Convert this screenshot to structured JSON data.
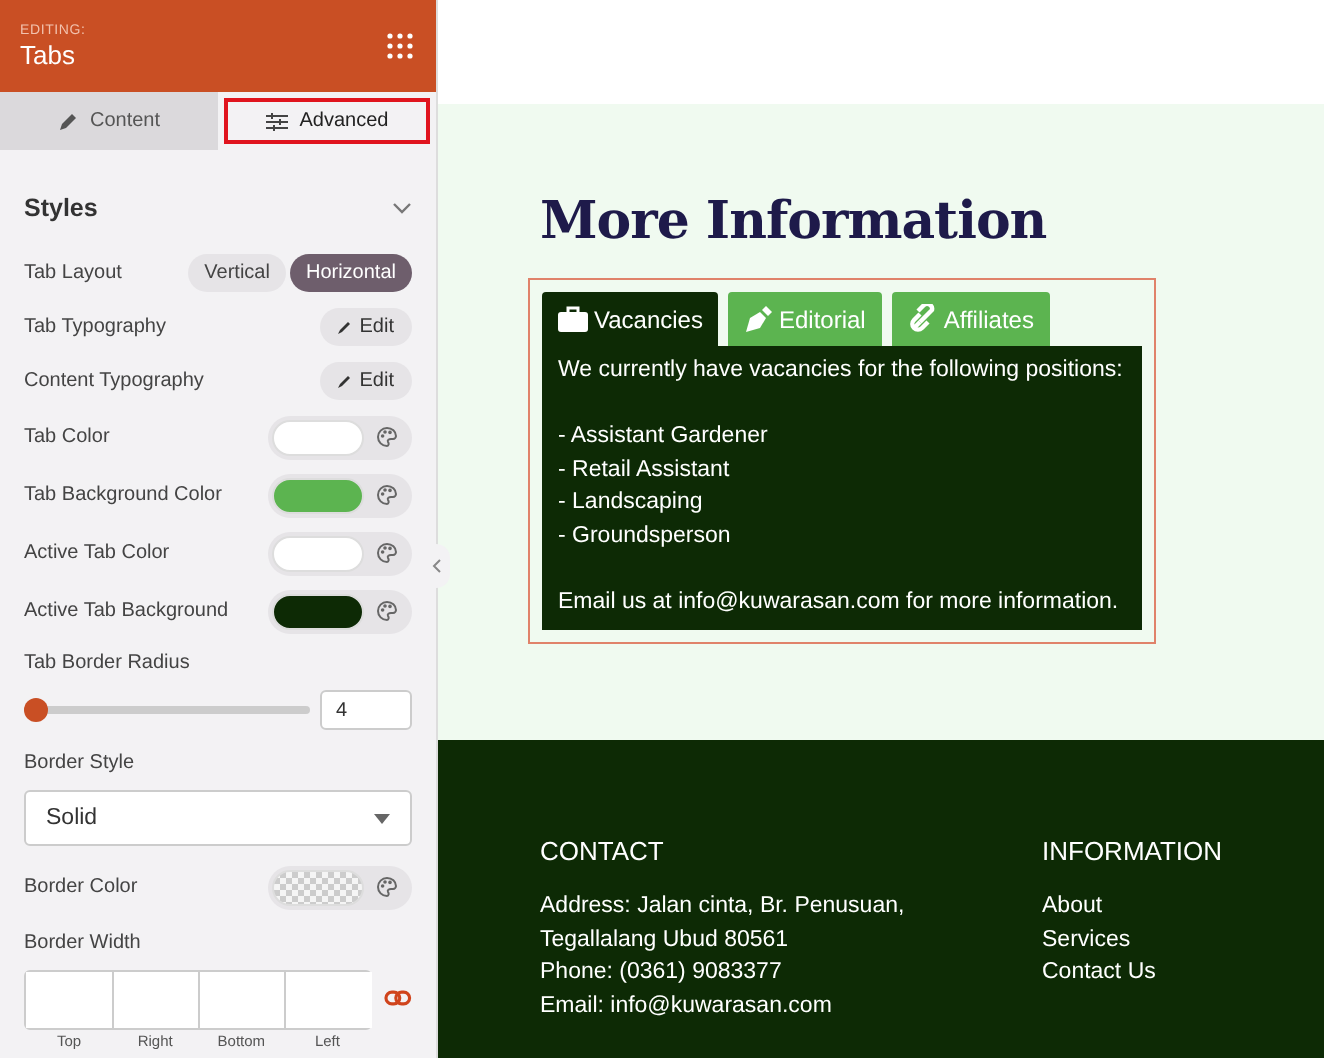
{
  "panel": {
    "editing_label": "EDITING:",
    "title": "Tabs",
    "tabs": [
      {
        "label": "Content",
        "selected": false,
        "highlighted": false
      },
      {
        "label": "Advanced",
        "selected": true,
        "highlighted": true
      }
    ],
    "section": {
      "title": "Styles",
      "expanded": true
    },
    "settings": [
      {
        "kind": "toggle",
        "label": "Tab Layout",
        "options": [
          {
            "label": "Vertical",
            "selected": false
          },
          {
            "label": "Horizontal",
            "selected": true
          }
        ]
      },
      {
        "kind": "edit",
        "label": "Tab Typography",
        "button": "Edit"
      },
      {
        "kind": "edit",
        "label": "Content Typography",
        "button": "Edit"
      },
      {
        "kind": "color",
        "label": "Tab Color",
        "color": "#ffffff"
      },
      {
        "kind": "color",
        "label": "Tab Background Color",
        "color": "#5cb450"
      },
      {
        "kind": "color",
        "label": "Active Tab Color",
        "color": "#ffffff"
      },
      {
        "kind": "color",
        "label": "Active Tab Background",
        "color": "#0d2a05"
      },
      {
        "kind": "slider",
        "label": "Tab Border Radius",
        "level": 0,
        "value": "4"
      },
      {
        "kind": "select",
        "label": "Border Style",
        "value": "Solid"
      },
      {
        "kind": "color",
        "label": "Border Color"
      },
      {
        "kind": "dimensions",
        "label": "Border Width",
        "sides": [
          "Top",
          "Right",
          "Bottom",
          "Left"
        ],
        "linked": true
      }
    ]
  },
  "preview": {
    "heading": "More Information",
    "tabs": [
      {
        "label": "Vacancies",
        "selected": true
      },
      {
        "label": "Editorial",
        "selected": false
      },
      {
        "label": "Affiliates",
        "selected": false
      }
    ],
    "content": [
      [
        "We currently have vacancies for the following positions:"
      ],
      [
        "- Assistant Gardener",
        "- Retail Assistant",
        "- Landscaping",
        "- Groundsperson"
      ],
      [
        "Email us at info@kuwarasan.com for more information."
      ]
    ]
  },
  "footer": {
    "columns": [
      {
        "title": "CONTACT",
        "lines": [
          "Address: Jalan cinta, Br. Penusuan,",
          "Tegallalang Ubud 80561",
          "Phone: (0361) 9083377",
          "Email: info@kuwarasan.com"
        ]
      },
      {
        "title": "INFORMATION",
        "lines": [
          "About",
          "Services",
          "Contact Us"
        ]
      }
    ]
  }
}
